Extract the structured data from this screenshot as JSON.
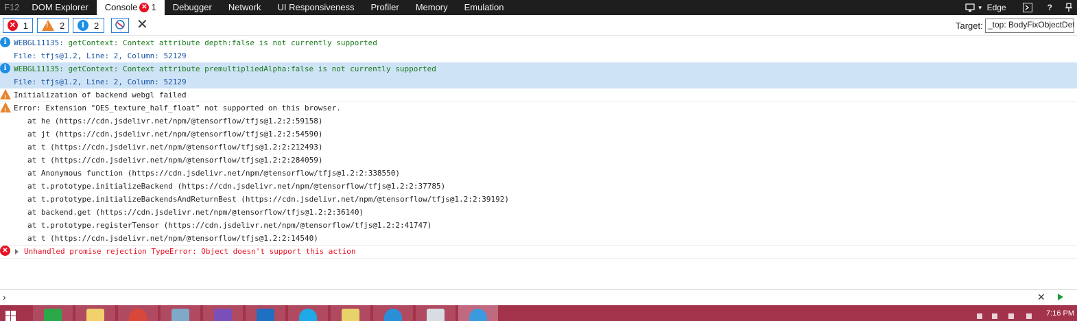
{
  "tabs": {
    "f12": "F12",
    "items": [
      {
        "label": "DOM Explorer"
      },
      {
        "label": "Console",
        "error_count": "1"
      },
      {
        "label": "Debugger"
      },
      {
        "label": "Network"
      },
      {
        "label": "UI Responsiveness"
      },
      {
        "label": "Profiler"
      },
      {
        "label": "Memory"
      },
      {
        "label": "Emulation"
      }
    ],
    "browser_mode": "Edge",
    "help": "?",
    "error_icon_glyph": "✕"
  },
  "toolbar": {
    "errors_count": "1",
    "warnings_count": "2",
    "messages_count": "2",
    "target_label": "Target:",
    "target_value": "_top: BodyFixObjectDetection"
  },
  "icons": {
    "info": "i",
    "warn": "!",
    "error": "✕",
    "clear": "✕",
    "prompt": "›",
    "input_clear": "✕"
  },
  "console": {
    "messages": [
      {
        "type": "info",
        "text": "WEBGL11135: getContext: Context attribute depth:false is not currently supported",
        "file": "File: tfjs@1.2, Line: 2, Column: 52129"
      },
      {
        "type": "info",
        "text": "WEBGL11135: getContext: Context attribute premultipliedAlpha:false is not currently supported",
        "file": "File: tfjs@1.2, Line: 2, Column: 52129"
      },
      {
        "type": "warn",
        "text": "Initialization of backend webgl failed"
      },
      {
        "type": "warn",
        "text": "Error: Extension \"OES_texture_half_float\" not supported on this browser.",
        "stack": [
          "at he (https://cdn.jsdelivr.net/npm/@tensorflow/tfjs@1.2:2:59158)",
          "at jt (https://cdn.jsdelivr.net/npm/@tensorflow/tfjs@1.2:2:54590)",
          "at t (https://cdn.jsdelivr.net/npm/@tensorflow/tfjs@1.2:2:212493)",
          "at t (https://cdn.jsdelivr.net/npm/@tensorflow/tfjs@1.2:2:284059)",
          "at Anonymous function (https://cdn.jsdelivr.net/npm/@tensorflow/tfjs@1.2:2:338550)",
          "at t.prototype.initializeBackend (https://cdn.jsdelivr.net/npm/@tensorflow/tfjs@1.2:2:37785)",
          "at t.prototype.initializeBackendsAndReturnBest (https://cdn.jsdelivr.net/npm/@tensorflow/tfjs@1.2:2:39192)",
          "at backend.get (https://cdn.jsdelivr.net/npm/@tensorflow/tfjs@1.2:2:36140)",
          "at t.prototype.registerTensor (https://cdn.jsdelivr.net/npm/@tensorflow/tfjs@1.2:2:41747)",
          "at t (https://cdn.jsdelivr.net/npm/@tensorflow/tfjs@1.2:2:14540)"
        ]
      },
      {
        "type": "error",
        "text": "Unhandled promise rejection TypeError: Object doesn't support this action"
      }
    ]
  },
  "taskbar": {
    "clock": "7:16 PM",
    "colors": {
      "bar": "#a3324b",
      "button": "#b04a61",
      "active": "#c06a80"
    }
  },
  "colors": {
    "info": "#1d8ee6",
    "warn": "#e8832e",
    "error": "#e81123",
    "highlight": "#cfe3f6",
    "message_blue": "#1a55a6",
    "message_green": "#1a7a1a"
  }
}
